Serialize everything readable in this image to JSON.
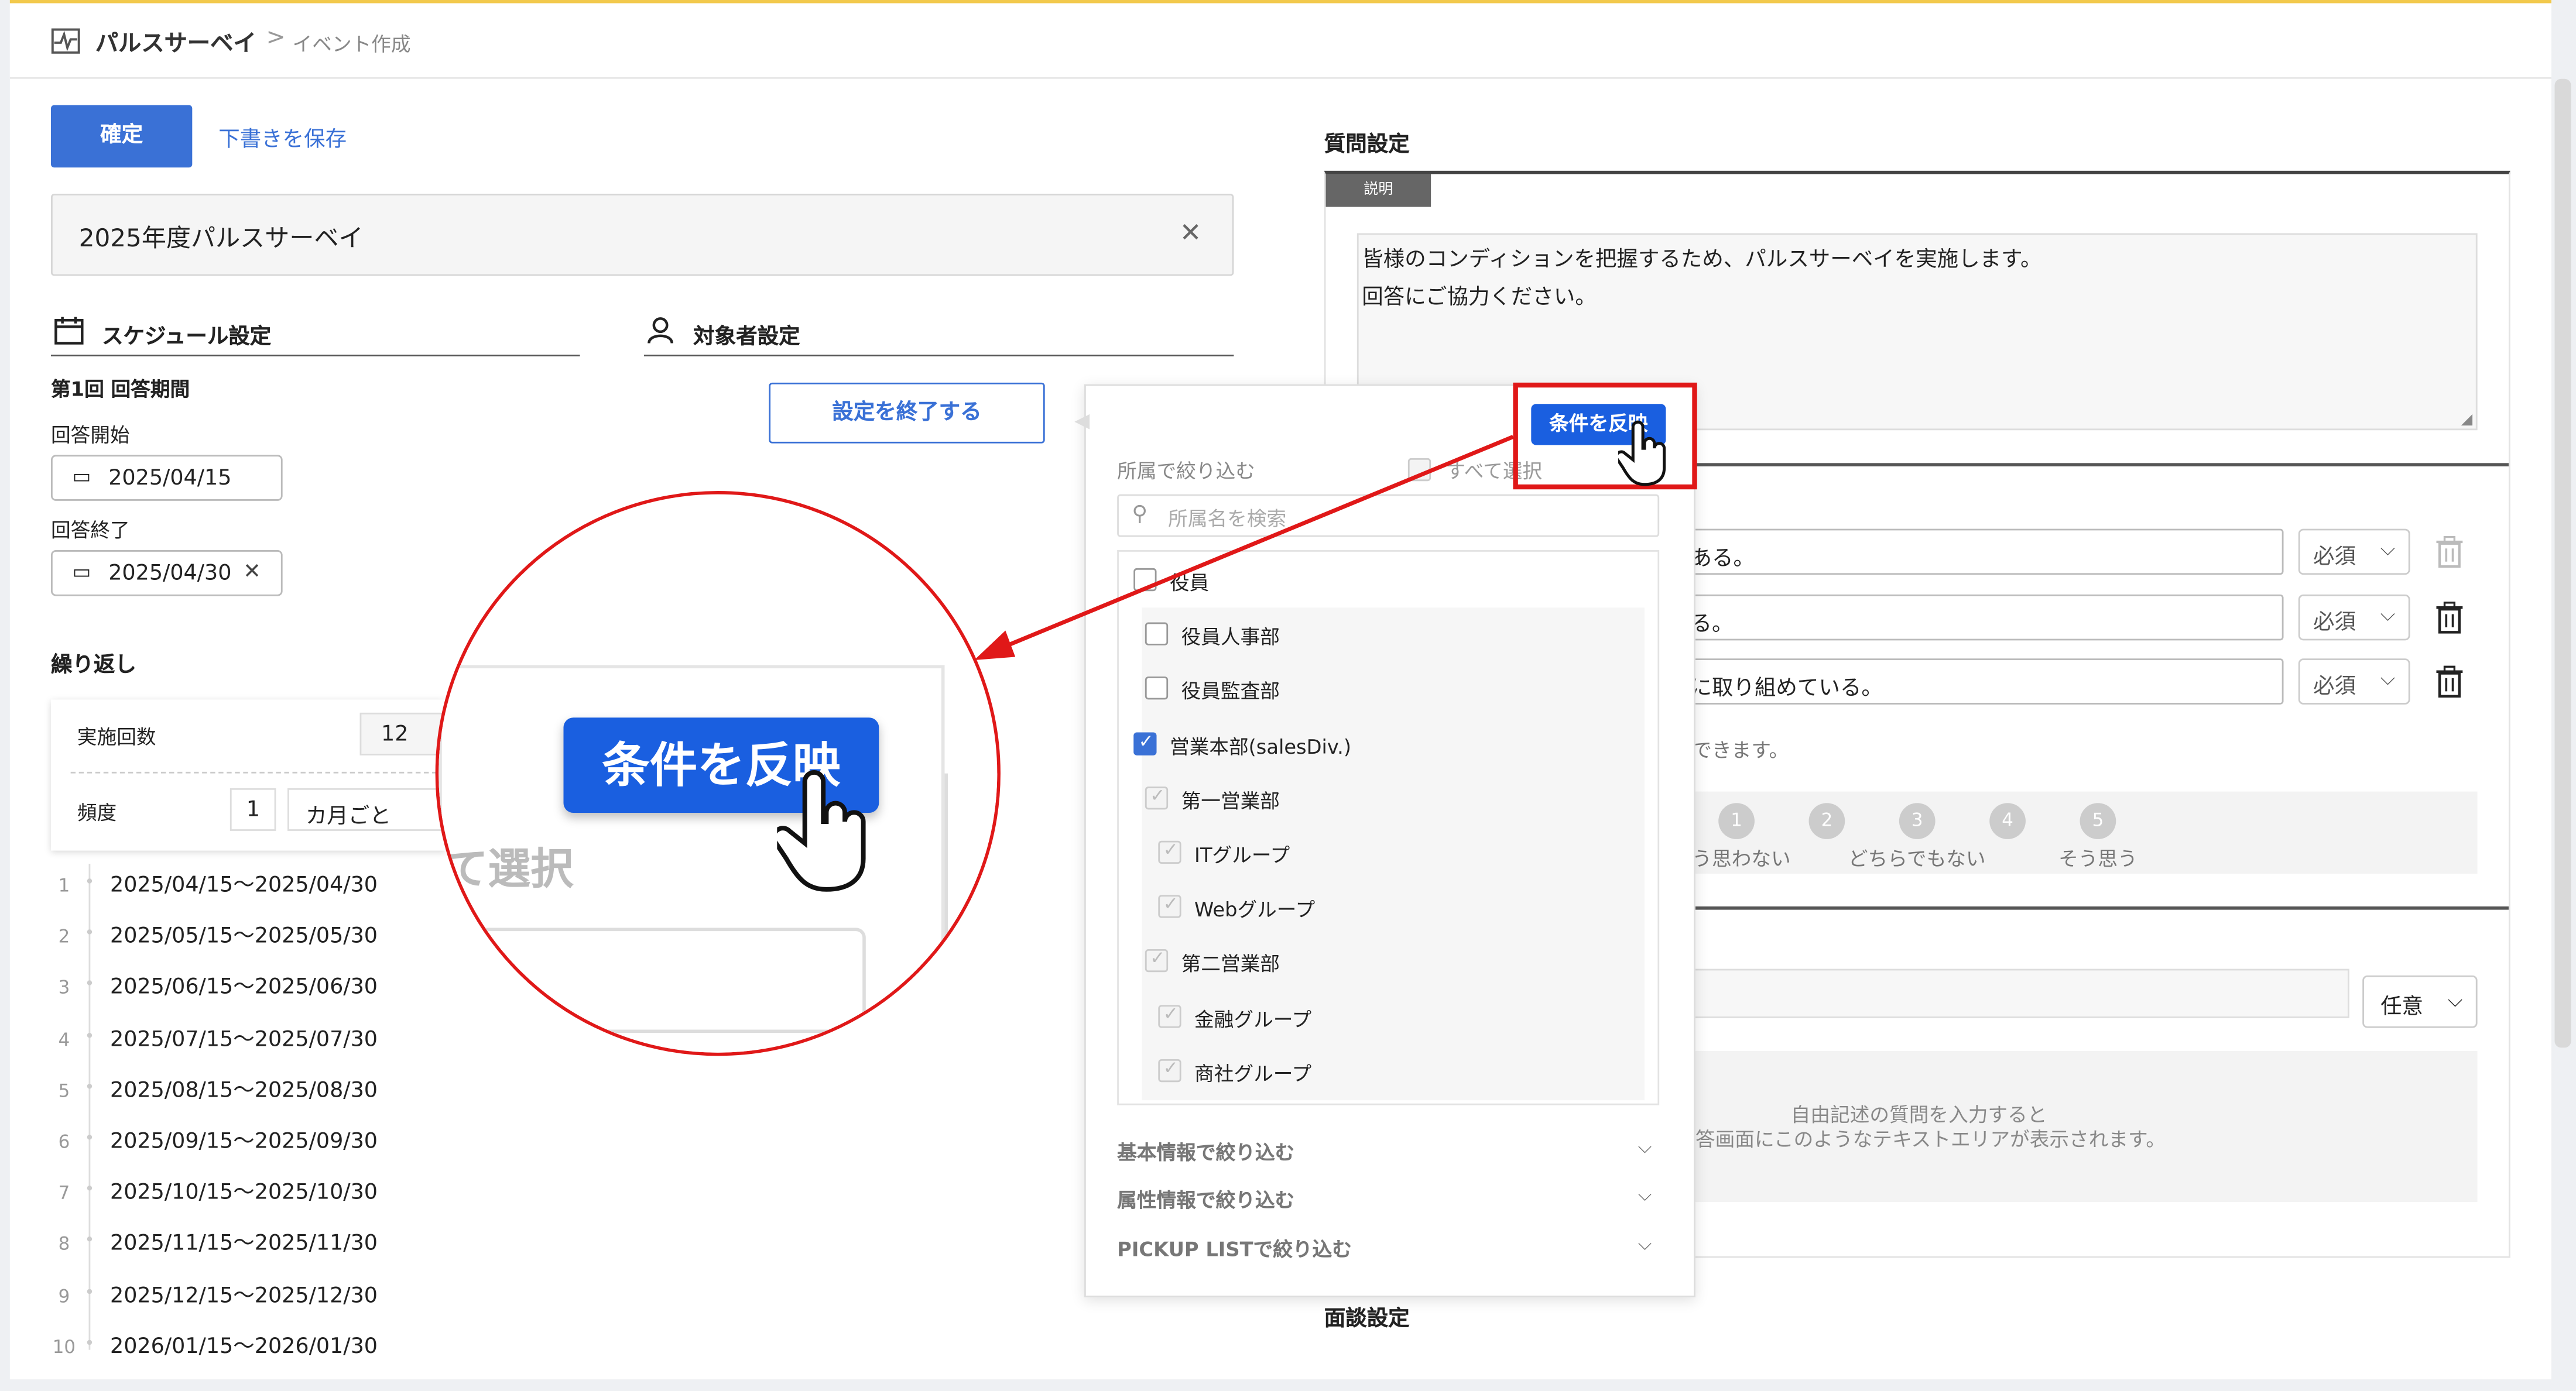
{
  "breadcrumb": {
    "app": "パルスサーベイ",
    "separator": ">",
    "current": "イベント作成"
  },
  "actions": {
    "confirm": "確定",
    "save_draft": "下書きを保存"
  },
  "title_field": {
    "value": "2025年度パルスサーベイ",
    "clear": "✕"
  },
  "schedule": {
    "heading": "スケジュール設定",
    "period_label": "第1回 回答期間",
    "start_label": "回答開始",
    "start_value": "2025/04/15",
    "end_label": "回答終了",
    "end_value": "2025/04/30",
    "repeat_label": "繰り返し",
    "count_label": "実施回数",
    "count_value": "12",
    "freq_label": "頻度",
    "freq_value": "1",
    "freq_unit": "カ月ごと",
    "periods": [
      {
        "n": "1",
        "range": "2025/04/15～2025/04/30"
      },
      {
        "n": "2",
        "range": "2025/05/15～2025/05/30"
      },
      {
        "n": "3",
        "range": "2025/06/15～2025/06/30"
      },
      {
        "n": "4",
        "range": "2025/07/15～2025/07/30"
      },
      {
        "n": "5",
        "range": "2025/08/15～2025/08/30"
      },
      {
        "n": "6",
        "range": "2025/09/15～2025/09/30"
      },
      {
        "n": "7",
        "range": "2025/10/15～2025/10/30"
      },
      {
        "n": "8",
        "range": "2025/11/15～2025/11/30"
      },
      {
        "n": "9",
        "range": "2025/12/15～2025/12/30"
      },
      {
        "n": "10",
        "range": "2026/01/15～2026/01/30"
      }
    ]
  },
  "target": {
    "heading": "対象者設定",
    "finish_button": "設定を終了する"
  },
  "filter_popup": {
    "dept_label": "所属で絞り込む",
    "select_all": "すべて選択",
    "apply_button": "条件を反映",
    "search_placeholder": "所属名を検索",
    "items": [
      {
        "label": "役員",
        "state": "off"
      },
      {
        "label": "役員人事部",
        "state": "off"
      },
      {
        "label": "役員監査部",
        "state": "off"
      },
      {
        "label": "営業本部(salesDiv.)",
        "state": "on"
      },
      {
        "label": "第一営業部",
        "state": "dim"
      },
      {
        "label": "ITグループ",
        "state": "dim"
      },
      {
        "label": "Webグループ",
        "state": "dim"
      },
      {
        "label": "第二営業部",
        "state": "dim"
      },
      {
        "label": "金融グループ",
        "state": "dim"
      },
      {
        "label": "商社グループ",
        "state": "dim"
      }
    ],
    "accordions": [
      "基本情報で絞り込む",
      "属性情報で絞り込む",
      "PICKUP LISTで絞り込む"
    ]
  },
  "zoom": {
    "apply_button": "条件を反映",
    "select_all_fragment": "て選択"
  },
  "questions": {
    "heading": "質問設定",
    "desc_tab": "説明",
    "desc_line1": "皆様のコンディションを把握するため、パルスサーベイを実施します。",
    "desc_line2": "回答にご協力ください。",
    "q_rows": [
      {
        "text": "ある。",
        "req": "必須"
      },
      {
        "text": "る。",
        "req": "必須"
      },
      {
        "text": "に取り組めている。",
        "req": "必須"
      }
    ],
    "hint": "できます。",
    "scale": [
      {
        "n": "1",
        "label": "う思わない"
      },
      {
        "n": "2",
        "label": ""
      },
      {
        "n": "3",
        "label": "どちらでもない"
      },
      {
        "n": "4",
        "label": ""
      },
      {
        "n": "5",
        "label": "そう思う"
      }
    ],
    "optional": "任意",
    "free_hint1": "自由記述の質問を入力すると",
    "free_hint2": "答画面にこのようなテキストエリアが表示されます。",
    "interview_heading": "面談設定"
  }
}
